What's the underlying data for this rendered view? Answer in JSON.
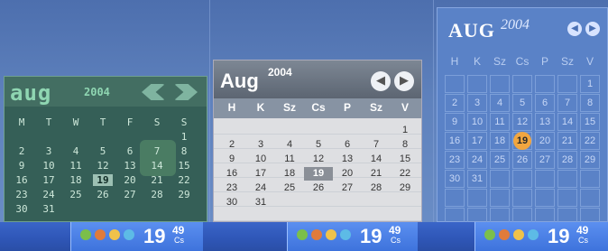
{
  "colors": {
    "desktop": "#5d7fb7",
    "taskbar": "#2f57b8",
    "tray": "#3e73dc"
  },
  "calendar1": {
    "month": "aug",
    "year": "2004",
    "nav": {
      "prev": "chevron-left-icon",
      "next": "chevron-right-icon"
    },
    "weekdays": [
      "M",
      "T",
      "W",
      "T",
      "F",
      "S",
      "S"
    ],
    "days": [
      "1",
      "2",
      "3",
      "4",
      "5",
      "6",
      "7",
      "8",
      "9",
      "10",
      "11",
      "12",
      "13",
      "14",
      "15",
      "16",
      "17",
      "18",
      "19",
      "20",
      "21",
      "22",
      "23",
      "24",
      "25",
      "26",
      "27",
      "28",
      "29",
      "30",
      "31"
    ],
    "today": "19"
  },
  "calendar2": {
    "month": "Aug",
    "year": "2004",
    "nav": {
      "prev": "arrow-left-icon",
      "next": "arrow-right-icon"
    },
    "weekdays": [
      "H",
      "K",
      "Sz",
      "Cs",
      "P",
      "Sz",
      "V"
    ],
    "days": [
      "1",
      "2",
      "3",
      "4",
      "5",
      "6",
      "7",
      "8",
      "9",
      "10",
      "11",
      "12",
      "13",
      "14",
      "15",
      "16",
      "17",
      "18",
      "19",
      "20",
      "21",
      "22",
      "23",
      "24",
      "25",
      "26",
      "27",
      "28",
      "29",
      "30",
      "31"
    ],
    "today": "19"
  },
  "calendar3": {
    "month": "AUG",
    "year": "2004",
    "nav": {
      "prev": "arrow-left-icon",
      "next": "arrow-right-icon"
    },
    "weekdays": [
      "H",
      "K",
      "Sz",
      "Cs",
      "P",
      "Sz",
      "V"
    ],
    "days": [
      "1",
      "2",
      "3",
      "4",
      "5",
      "6",
      "7",
      "8",
      "9",
      "10",
      "11",
      "12",
      "13",
      "14",
      "15",
      "16",
      "17",
      "18",
      "19",
      "20",
      "21",
      "22",
      "23",
      "24",
      "25",
      "26",
      "27",
      "28",
      "29",
      "30",
      "31"
    ],
    "today": "19"
  },
  "tray": [
    {
      "hour": "19",
      "minute": "49",
      "day": "Cs"
    },
    {
      "hour": "19",
      "minute": "49",
      "day": "Cs"
    },
    {
      "hour": "19",
      "minute": "49",
      "day": "Cs"
    }
  ]
}
